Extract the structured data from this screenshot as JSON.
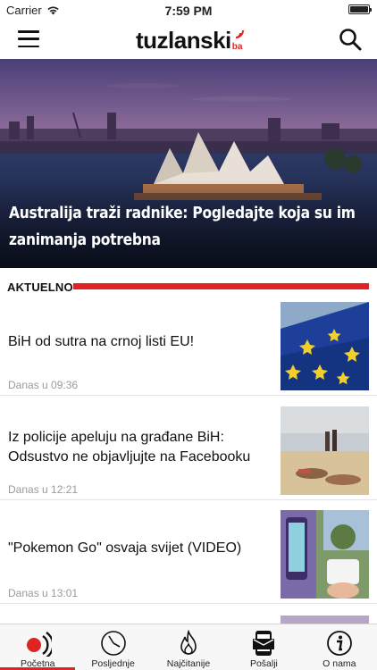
{
  "status_bar": {
    "carrier": "Carrier",
    "time": "7:59 PM"
  },
  "header": {
    "logo_text": "tuzlanski",
    "logo_suffix": "ba"
  },
  "hero": {
    "title": "Australija traži radnike: Pogledajte koja su im zanimanja potrebna",
    "slide_count": 6,
    "active_slide": 6
  },
  "section": {
    "label": "AKTUELNO"
  },
  "articles": [
    {
      "title": "BiH od sutra na crnoj listi EU!",
      "time": "Danas u 09:36",
      "thumb_icon": "eu-flag-photo"
    },
    {
      "title": "Iz policije apeluju na građane BiH: Odsustvo ne objavljujte na Facebooku",
      "time": "Danas u 12:21",
      "thumb_icon": "beach-photo"
    },
    {
      "title": "\"Pokemon Go\" osvaja svijet (VIDEO)",
      "time": "Danas u 13:01",
      "thumb_icon": "pokemon-phone-photo"
    }
  ],
  "tabs": [
    {
      "label": "Početna",
      "icon": "broadcast-icon",
      "active": true
    },
    {
      "label": "Posljednje",
      "icon": "clock-icon",
      "active": false
    },
    {
      "label": "Najčitanije",
      "icon": "flame-icon",
      "active": false
    },
    {
      "label": "Pošalji",
      "icon": "send-phone-icon",
      "active": false
    },
    {
      "label": "O nama",
      "icon": "info-icon",
      "active": false
    }
  ],
  "colors": {
    "accent": "#e02424",
    "text": "#111111",
    "muted": "#9a9a9a"
  }
}
